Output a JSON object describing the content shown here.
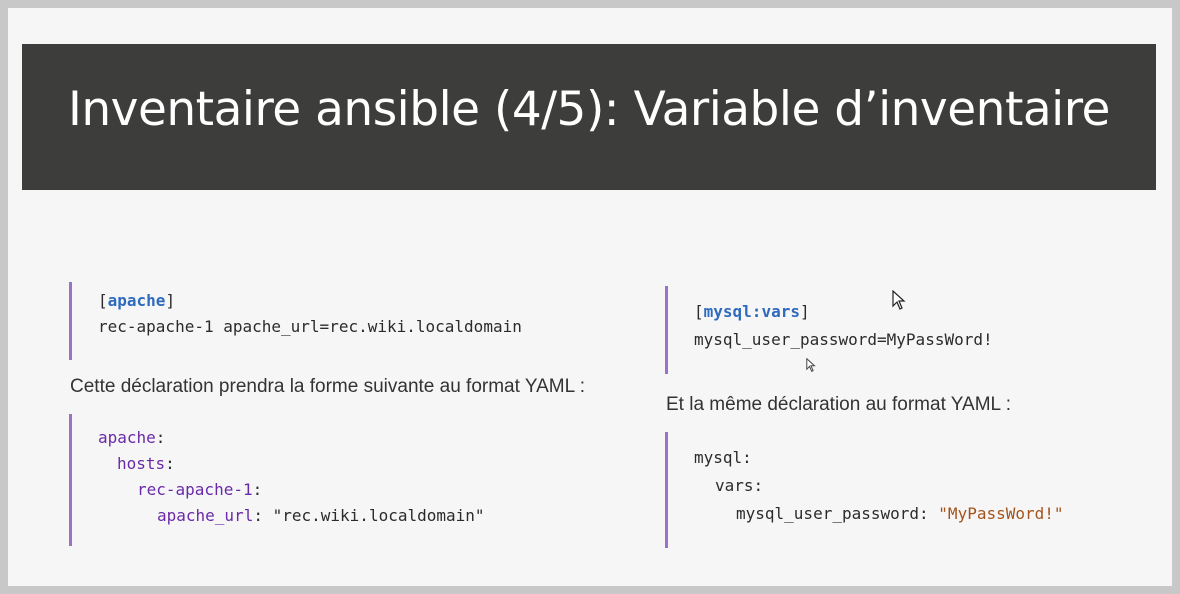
{
  "slide": {
    "title": "Inventaire ansible (4/5): Variable d’inventaire"
  },
  "left": {
    "ini": {
      "open_bracket": "[",
      "section": "apache",
      "close_bracket": "]",
      "line2": "rec-apache-1 apache_url=rec.wiki.localdomain"
    },
    "caption": "Cette déclaration prendra la forme suivante au format YAML :",
    "yaml": {
      "l1_key": "apache",
      "l1_colon": ":",
      "l2_key": "hosts",
      "l2_colon": ":",
      "l3_key": "rec-apache-1",
      "l3_colon": ":",
      "l4_key": "apache_url",
      "l4_colon": ":",
      "l4_value": "\"rec.wiki.localdomain\""
    }
  },
  "right": {
    "ini": {
      "open_bracket": "[",
      "section": "mysql:vars",
      "close_bracket": "]",
      "line2": "mysql_user_password=MyPassWord!"
    },
    "caption": "Et la même déclaration au format YAML :",
    "yaml": {
      "l1": "mysql:",
      "l2": "vars:",
      "l3_key": "mysql_user_password:",
      "l3_value": "\"MyPassWord!\""
    }
  },
  "colors": {
    "banner": "#3d3d3b",
    "accent_bar": "#9b72c9",
    "section_blue": "#2f6bbd",
    "yaml_purple": "#6a2aa7",
    "string_orange": "#a3541c"
  }
}
